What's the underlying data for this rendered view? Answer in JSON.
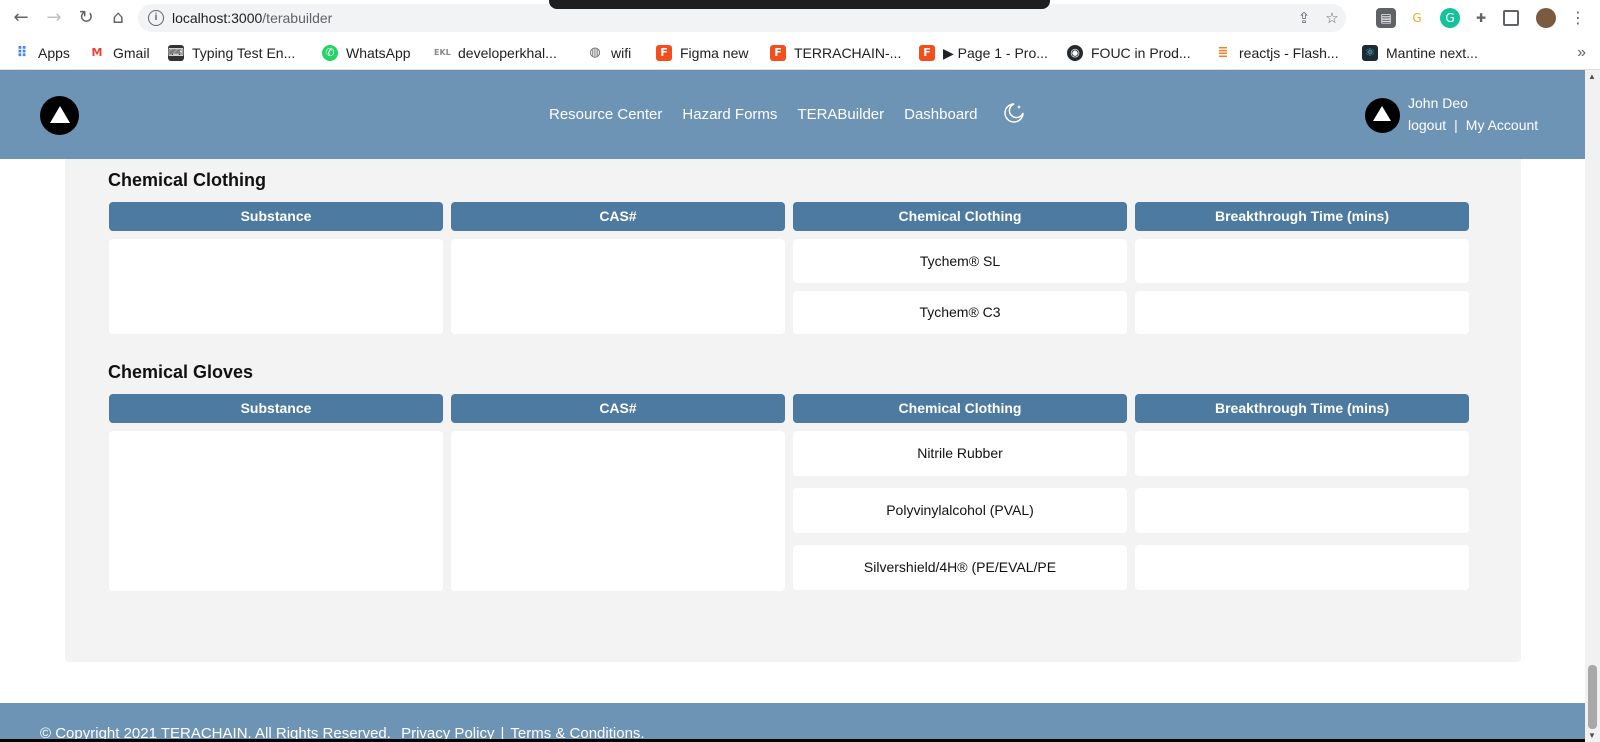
{
  "browser": {
    "url_host": "localhost:3000",
    "url_path": "/terabuilder",
    "bookmarks": [
      {
        "label": "Apps",
        "icon": "apps-grid-icon",
        "color": "#4285f4"
      },
      {
        "label": "Gmail",
        "icon": "gmail-icon",
        "color": "#ea4335"
      },
      {
        "label": "Typing Test En...",
        "icon": "typing-test-icon",
        "color": "#333333"
      },
      {
        "label": "WhatsApp",
        "icon": "whatsapp-icon",
        "color": "#25d366"
      },
      {
        "label": "developerkhal...",
        "icon": "ekhal-icon",
        "color": "#888888"
      },
      {
        "label": "wifi",
        "icon": "globe-icon",
        "color": "#5f6368"
      },
      {
        "label": "Figma new",
        "icon": "figma-icon",
        "color": "#f24e1e"
      },
      {
        "label": "TERRACHAIN-...",
        "icon": "figma-icon",
        "color": "#f24e1e"
      },
      {
        "label": "▶ Page 1 - Pro...",
        "icon": "figma-icon",
        "color": "#f24e1e"
      },
      {
        "label": "FOUC in Prod...",
        "icon": "github-icon",
        "color": "#24292e"
      },
      {
        "label": "reactjs - Flash...",
        "icon": "stackoverflow-icon",
        "color": "#f48024"
      },
      {
        "label": "Mantine next...",
        "icon": "react-icon",
        "color": "#3fa9c9"
      }
    ],
    "more_bookmarks": "»"
  },
  "header": {
    "nav": [
      "Resource Center",
      "Hazard Forms",
      "TERABuilder",
      "Dashboard"
    ],
    "user_name": "John Deo",
    "logout": "logout",
    "separator": "|",
    "my_account": "My Account"
  },
  "sections": [
    {
      "title": "Chemical Clothing",
      "columns": [
        "Substance",
        "CAS#",
        "Chemical Clothing",
        "Breakthrough Time (mins)"
      ],
      "materials": [
        "Tychem® SL",
        "Tychem® C3"
      ]
    },
    {
      "title": "Chemical Gloves",
      "columns": [
        "Substance",
        "CAS#",
        "Chemical Clothing",
        "Breakthrough Time (mins)"
      ],
      "materials": [
        "Nitrile Rubber",
        "Polyvinylalcohol (PVAL)",
        "Silvershield/4H® (PE/EVAL/PE"
      ]
    }
  ],
  "footer": {
    "copyright": "© Copyright 2021 TERACHAIN. All Rights Reserved.",
    "privacy": "Privacy Policy",
    "separator": "|",
    "terms": "Terms & Conditions."
  },
  "colors": {
    "header_bg": "#6d93b5",
    "table_header_bg": "#4d7aa0",
    "panel_bg": "#f3f3f3"
  }
}
